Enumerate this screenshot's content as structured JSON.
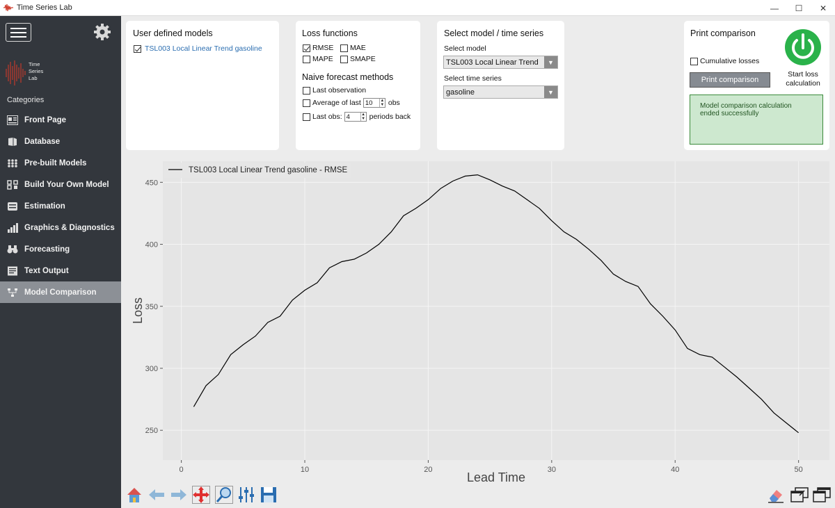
{
  "window": {
    "title": "Time Series Lab",
    "controls": [
      "—",
      "☐",
      "✕"
    ]
  },
  "sidebar": {
    "logo_text": [
      "Time",
      "Series",
      "Lab"
    ],
    "categories_label": "Categories",
    "items": [
      {
        "label": "Front Page",
        "icon": "front-page-icon",
        "active": false
      },
      {
        "label": "Database",
        "icon": "database-icon",
        "active": false
      },
      {
        "label": "Pre-built Models",
        "icon": "grid-icon",
        "active": false
      },
      {
        "label": "Build Your Own Model",
        "icon": "build-icon",
        "active": false
      },
      {
        "label": "Estimation",
        "icon": "estimation-icon",
        "active": false
      },
      {
        "label": "Graphics & Diagnostics",
        "icon": "bar-chart-icon",
        "active": false
      },
      {
        "label": "Forecasting",
        "icon": "binoculars-icon",
        "active": false
      },
      {
        "label": "Text Output",
        "icon": "text-output-icon",
        "active": false
      },
      {
        "label": "Model Comparison",
        "icon": "model-comparison-icon",
        "active": true
      }
    ]
  },
  "user_models": {
    "title": "User defined models",
    "items": [
      {
        "label": "TSL003 Local Linear Trend gasoline",
        "checked": true
      }
    ]
  },
  "loss_functions": {
    "title": "Loss functions",
    "rmse": {
      "label": "RMSE",
      "checked": true
    },
    "mae": {
      "label": "MAE",
      "checked": false
    },
    "mape": {
      "label": "MAPE",
      "checked": false
    },
    "smape": {
      "label": "SMAPE",
      "checked": false
    },
    "naive_title": "Naive forecast methods",
    "last_observation": {
      "label": "Last observation",
      "checked": false
    },
    "average_of_last": {
      "label": "Average of last",
      "value": "10",
      "suffix": "obs",
      "checked": false
    },
    "last_obs": {
      "label": "Last obs:",
      "value": "4",
      "suffix": "periods back",
      "checked": false
    }
  },
  "select_model": {
    "title": "Select model / time series",
    "model_label": "Select model",
    "model_value": "TSL003 Local Linear Trend",
    "series_label": "Select time series",
    "series_value": "gasoline"
  },
  "print_comparison": {
    "title": "Print comparison",
    "cumulative_label": "Cumulative losses",
    "cumulative_checked": false,
    "button_label": "Print comparison",
    "start_label_1": "Start loss",
    "start_label_2": "calculation",
    "status": "Model comparison calculation ended successfully",
    "status_color": "#cde8cf"
  },
  "chart_data": {
    "type": "line",
    "title": "",
    "xlabel": "Lead Time",
    "ylabel": "Loss",
    "xlim": [
      -1.5,
      52.5
    ],
    "ylim": [
      226,
      467
    ],
    "xticks": [
      0,
      10,
      20,
      30,
      40,
      50
    ],
    "yticks": [
      250,
      300,
      350,
      400,
      450
    ],
    "grid": true,
    "legend_position": "top-left",
    "series": [
      {
        "name": "TSL003 Local Linear Trend gasoline - RMSE",
        "color": "#000000",
        "x": [
          1,
          2,
          3,
          4,
          5,
          6,
          7,
          8,
          9,
          10,
          11,
          12,
          13,
          14,
          15,
          16,
          17,
          18,
          19,
          20,
          21,
          22,
          23,
          24,
          25,
          26,
          27,
          28,
          29,
          30,
          31,
          32,
          33,
          34,
          35,
          36,
          37,
          38,
          39,
          40,
          41,
          42,
          43,
          44,
          45,
          46,
          47,
          48,
          49,
          50
        ],
        "y": [
          269,
          286,
          295,
          311,
          319,
          326,
          337,
          342,
          355,
          363,
          369,
          381,
          386,
          388,
          393,
          400,
          410,
          423,
          429,
          436,
          445,
          451,
          455,
          456,
          452,
          447,
          443,
          436,
          429,
          419,
          410,
          404,
          396,
          387,
          376,
          370,
          366,
          352,
          342,
          331,
          316,
          311,
          309,
          301,
          293,
          284,
          275,
          264,
          256,
          248
        ]
      }
    ]
  },
  "toolbar": {
    "left": [
      "home-icon",
      "back-arrow-icon",
      "forward-arrow-icon",
      "pan-icon",
      "zoom-icon",
      "configure-icon",
      "save-icon"
    ],
    "right": [
      "eraser-icon",
      "window-restore-icon",
      "window-popout-icon"
    ]
  }
}
